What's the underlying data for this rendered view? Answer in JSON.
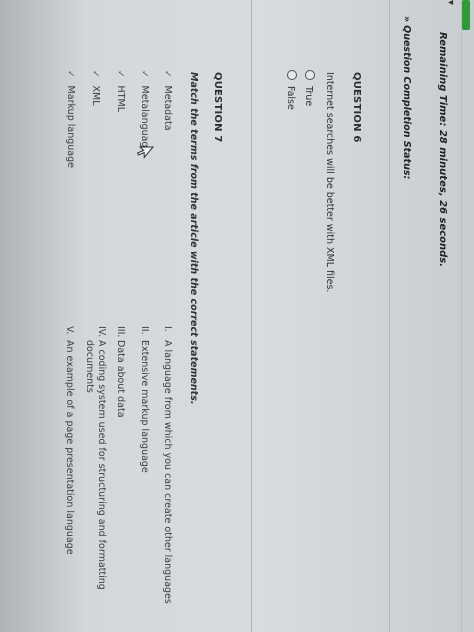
{
  "header": {
    "remaining_time": "Remaining Time: 28 minutes, 26 seconds.",
    "progress_color": "#2f9a3a"
  },
  "status_toggle": {
    "chevron": "»",
    "label": "Question Completion Status:"
  },
  "question6": {
    "title": "QUESTION 6",
    "text": "Internet searches will be better with XML files.",
    "options": [
      "True",
      "False"
    ]
  },
  "question7": {
    "title": "QUESTION 7",
    "instruction": "Match the terms from the article with the correct statements.",
    "terms": [
      "Metadata",
      "Metalanguage",
      "HTML",
      "XML",
      "Markup language"
    ],
    "statements": [
      {
        "num": "I.",
        "text": "A language from which you can create other languages"
      },
      {
        "num": "II.",
        "text": "Extensive markup language"
      },
      {
        "num": "III.",
        "text": "Data about data"
      },
      {
        "num": "IV.",
        "text": "A coding system used for structuring and formatting",
        "text2": "documents"
      },
      {
        "num": "V.",
        "text": "An example of a page presentation language"
      }
    ]
  }
}
